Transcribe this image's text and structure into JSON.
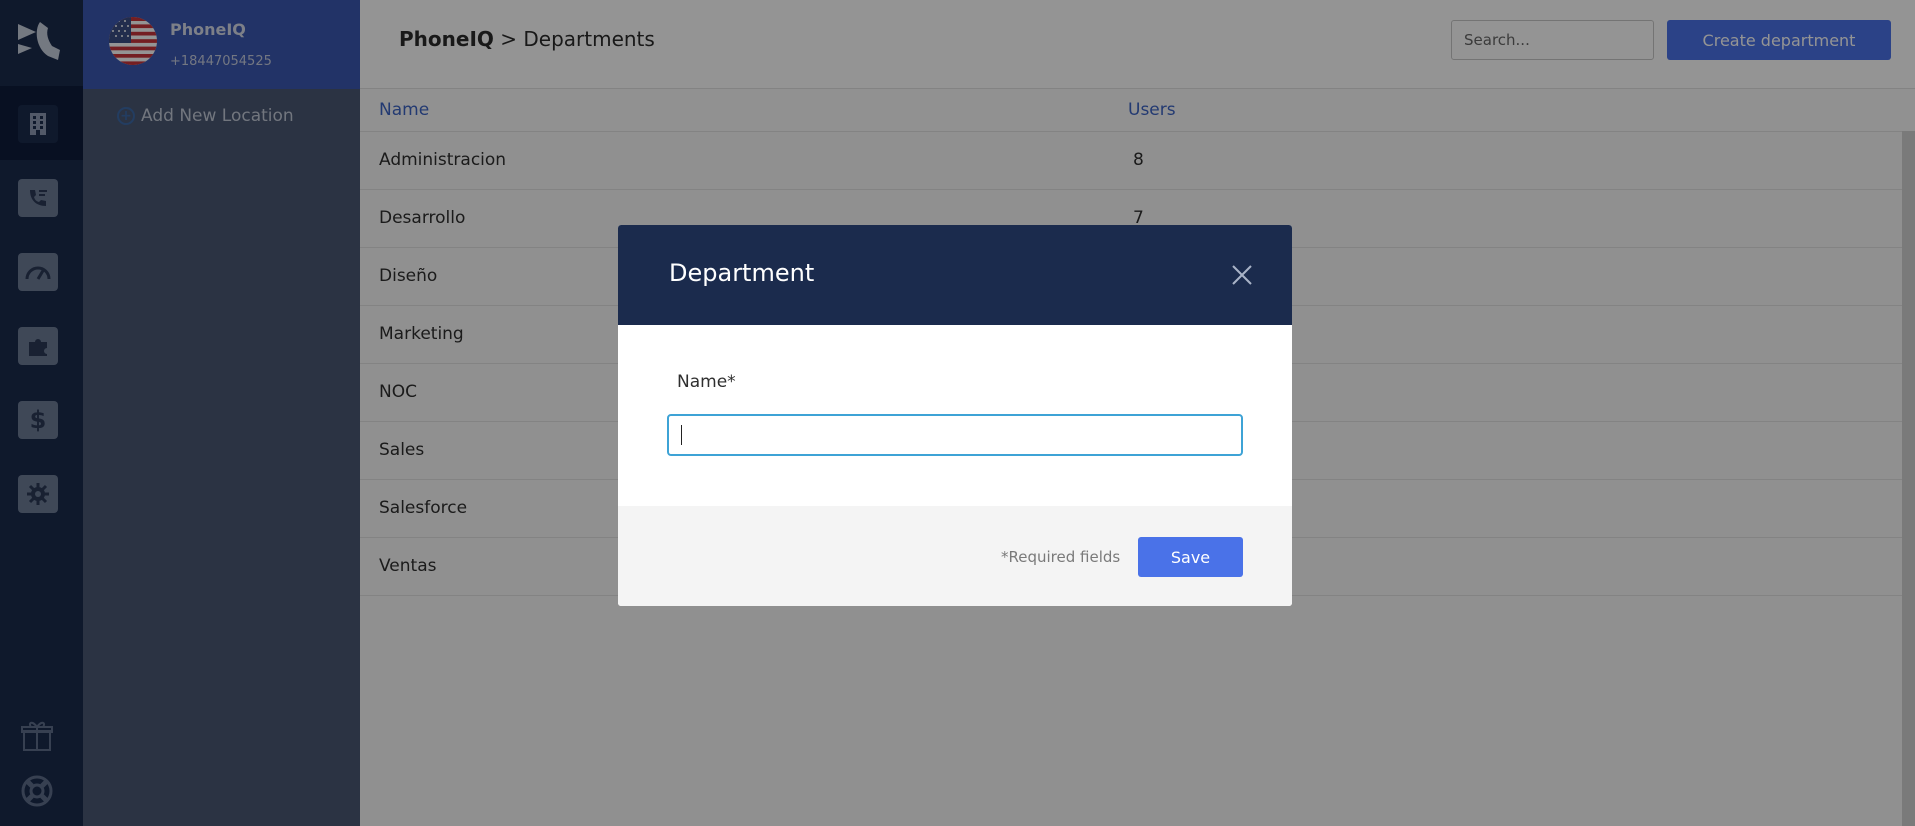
{
  "rail": {
    "logo_icon": "phoneiq-logo-icon",
    "items": [
      {
        "icon": "building-icon",
        "active": true
      },
      {
        "icon": "call-list-icon",
        "active": false
      },
      {
        "icon": "speedometer-icon",
        "active": false
      },
      {
        "icon": "puzzle-icon",
        "active": false
      },
      {
        "icon": "dollar-icon",
        "active": false
      },
      {
        "icon": "gear-icon",
        "active": false
      }
    ],
    "bottom": [
      "gift-icon",
      "lifebuoy-icon"
    ]
  },
  "location": {
    "name": "PhoneIQ",
    "phone": "+18447054525",
    "flag_icon": "us-flag-icon",
    "add_label": "Add New Location"
  },
  "header": {
    "crumb_root": "PhoneIQ",
    "crumb_sep": ">",
    "crumb_page": "Departments",
    "search_placeholder": "Search...",
    "create_label": "Create department"
  },
  "table": {
    "columns": [
      "Name",
      "Users"
    ],
    "rows": [
      {
        "name": "Administracion",
        "users": "8"
      },
      {
        "name": "Desarrollo",
        "users": "7"
      },
      {
        "name": "Diseño",
        "users": ""
      },
      {
        "name": "Marketing",
        "users": ""
      },
      {
        "name": "NOC",
        "users": ""
      },
      {
        "name": "Sales",
        "users": ""
      },
      {
        "name": "Salesforce",
        "users": ""
      },
      {
        "name": "Ventas",
        "users": ""
      }
    ]
  },
  "modal": {
    "title": "Department",
    "name_label": "Name*",
    "name_value": "",
    "required_note": "*Required fields",
    "save_label": "Save"
  },
  "colors": {
    "navy": "#1b2b4d",
    "accent": "#4a72e8",
    "link": "#3d64c4",
    "focus": "#3ea3d6"
  }
}
